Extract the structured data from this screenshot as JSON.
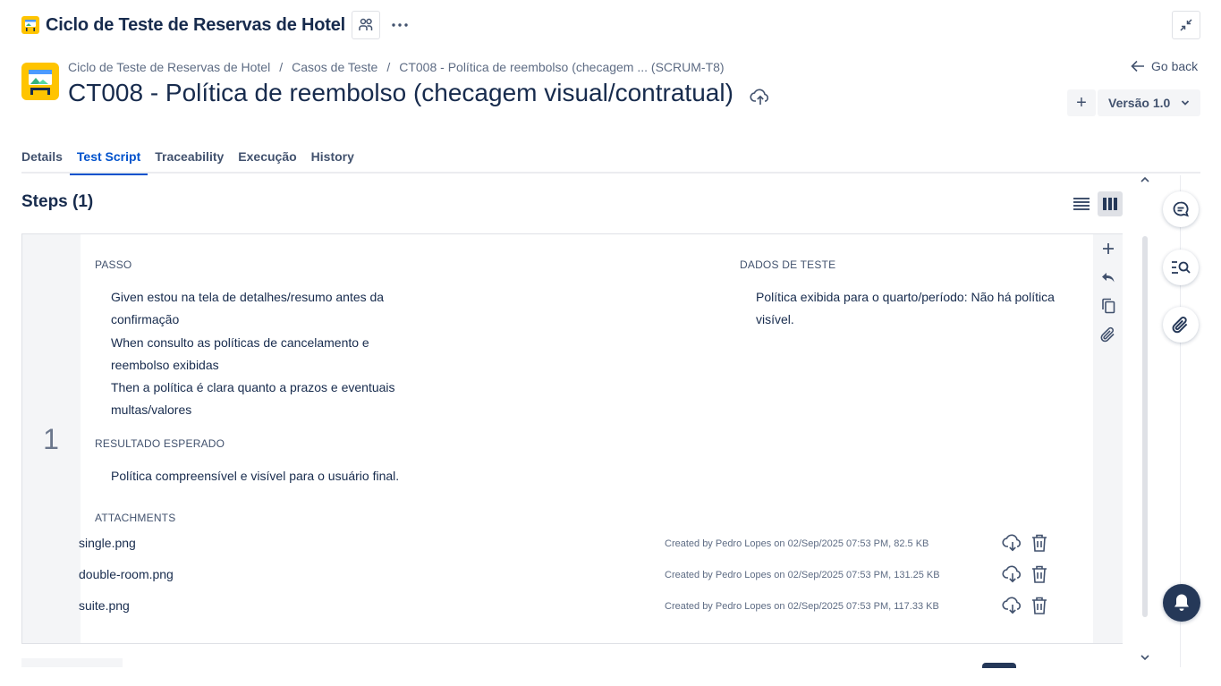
{
  "topbar": {
    "title": "Ciclo de Teste de Reservas de Hotel"
  },
  "breadcrumb": {
    "items": [
      "Ciclo de Teste de Reservas de Hotel",
      "Casos de Teste",
      "CT008 - Política de reembolso (checagem ... (SCRUM-T8)"
    ],
    "separator": "/"
  },
  "header": {
    "title": "CT008 - Política de reembolso (checagem visual/contratual)",
    "go_back": "Go back",
    "add_label": "+",
    "version": "Versão 1.0"
  },
  "tabs": [
    {
      "label": "Details",
      "active": false
    },
    {
      "label": "Test Script",
      "active": true
    },
    {
      "label": "Traceability",
      "active": false
    },
    {
      "label": "Execução",
      "active": false
    },
    {
      "label": "History",
      "active": false
    }
  ],
  "steps": {
    "title": "Steps (1)",
    "items": [
      {
        "number": "1",
        "passo_label": "PASSO",
        "passo_lines": [
          "Given estou na tela de detalhes/resumo antes da",
          "confirmação",
          "When consulto as políticas de cancelamento e",
          "reembolso exibidas",
          "Then a política é clara quanto a prazos e eventuais",
          "multas/valores"
        ],
        "dados_label": "DADOS DE TESTE",
        "dados_lines": [
          "Política exibida para o quarto/período: Não há política",
          "visível."
        ],
        "resultado_label": "RESULTADO ESPERADO",
        "resultado_text": "Política compreensível e visível para o usuário final.",
        "attachments_label": "ATTACHMENTS",
        "attachments": [
          {
            "name": "single.png",
            "meta": "Created by Pedro Lopes on 02/Sep/2025 07:53 PM, 82.5 KB"
          },
          {
            "name": "double-room.png",
            "meta": "Created by Pedro Lopes on 02/Sep/2025 07:53 PM, 131.25 KB"
          },
          {
            "name": "suite.png",
            "meta": "Created by Pedro Lopes on 02/Sep/2025 07:53 PM, 117.33 KB"
          }
        ]
      }
    ]
  },
  "colors": {
    "accent": "#0052cc",
    "text": "#172b4d",
    "muted": "#42526e",
    "icon_yellow": "#ffc400",
    "bell_bg": "#253858"
  },
  "icons": [
    "app-icon",
    "people-icon",
    "more-icon",
    "collapse-icon",
    "cloud-upload-icon",
    "arrow-left-icon",
    "chevron-down-icon",
    "list-view-icon",
    "column-view-icon",
    "add-icon",
    "undo-icon",
    "copy-icon",
    "paperclip-icon",
    "download-icon",
    "trash-icon",
    "comment-icon",
    "search-list-icon",
    "bell-icon"
  ]
}
